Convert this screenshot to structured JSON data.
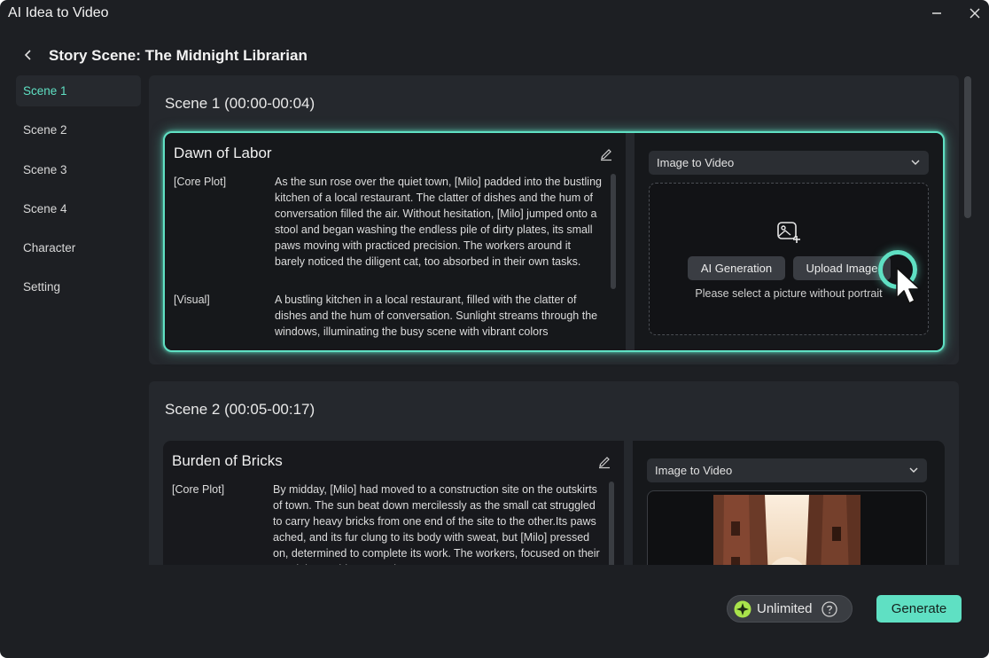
{
  "app": {
    "title": "AI Idea to Video"
  },
  "header": {
    "title": "Story Scene: The Midnight Librarian"
  },
  "sidebar": {
    "items": [
      {
        "label": "Scene 1",
        "active": true
      },
      {
        "label": "Scene 2",
        "active": false
      },
      {
        "label": "Scene 3",
        "active": false
      },
      {
        "label": "Scene 4",
        "active": false
      },
      {
        "label": "Character",
        "active": false
      },
      {
        "label": "Setting",
        "active": false
      }
    ]
  },
  "scenes": [
    {
      "heading": "Scene 1 (00:00-00:04)",
      "card_title": "Dawn of Labor",
      "core_plot_label": "[Core Plot]",
      "core_plot": "As the sun rose over the quiet town, [Milo] padded into the bustling kitchen of a local restaurant. The clatter of dishes and the hum of conversation filled the air. Without hesitation, [Milo] jumped onto a stool and began washing the endless pile of dirty plates, its small paws moving with practiced precision. The workers around it barely noticed the diligent cat, too absorbed in their own tasks.",
      "visual_label": "[Visual]",
      "visual": "A bustling kitchen in a local restaurant, filled with the clatter of dishes and the hum of conversation. Sunlight streams through the windows, illuminating the busy scene with vibrant colors",
      "mode": "Image to Video",
      "ai_generation": "AI Generation",
      "upload_image": "Upload Image",
      "hint": "Please select a picture without portrait"
    },
    {
      "heading": "Scene 2 (00:05-00:17)",
      "card_title": "Burden of Bricks",
      "core_plot_label": "[Core Plot]",
      "core_plot": "By midday, [Milo] had moved to a construction site on the outskirts of town. The sun beat down mercilessly as the small cat struggled to carry heavy bricks from one end of the site to the other.Its paws ached, and its fur clung to its body with sweat, but [Milo] pressed on, determined to complete its work. The workers, focused on their own labor, paid no attention to",
      "mode": "Image to Video"
    }
  ],
  "footer": {
    "unlimited": "Unlimited",
    "generate": "Generate"
  },
  "colors": {
    "accent": "#5fe0c3",
    "background": "#1d1f23",
    "panel": "#25282d"
  }
}
